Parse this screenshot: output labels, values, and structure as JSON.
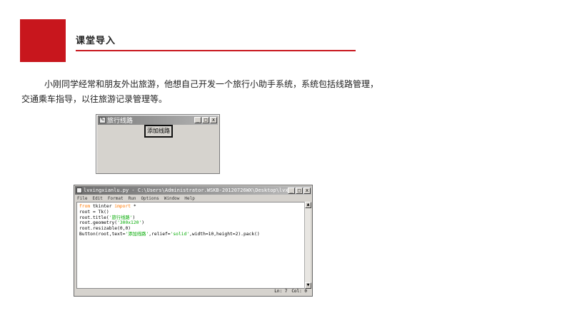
{
  "slide": {
    "header_title": "课堂导入",
    "intro_text": "小刚同学经常和朋友外出旅游，他想自己开发一个旅行小助手系统，系统包括线路管理，交通乘车指导，以往旅游记录管理等。",
    "accent_color": "#c8161d"
  },
  "tk_window": {
    "title": "旅行线路",
    "button_label": "添加线路",
    "window_buttons": [
      "_",
      "□",
      "x"
    ]
  },
  "idle_window": {
    "title": "lvxingxianlu.py - C:\\Users\\Administrator.WSKB-20120726WX\\Desktop\\lvxi...",
    "window_buttons": [
      "_",
      "□",
      "x"
    ],
    "menu": [
      "File",
      "Edit",
      "Format",
      "Run",
      "Options",
      "Window",
      "Help"
    ],
    "code_lines": [
      {
        "parts": [
          {
            "t": "from",
            "c": "kw"
          },
          {
            "t": " tkinter ",
            "c": ""
          },
          {
            "t": "import",
            "c": "kw"
          },
          {
            "t": " *",
            "c": ""
          }
        ]
      },
      {
        "parts": [
          {
            "t": "root = Tk()",
            "c": ""
          }
        ]
      },
      {
        "parts": [
          {
            "t": "root.title(",
            "c": ""
          },
          {
            "t": "'旅行线路'",
            "c": "str"
          },
          {
            "t": ")",
            "c": ""
          }
        ]
      },
      {
        "parts": [
          {
            "t": "root.geometry(",
            "c": ""
          },
          {
            "t": "'300x120'",
            "c": "str"
          },
          {
            "t": ")",
            "c": ""
          }
        ]
      },
      {
        "parts": [
          {
            "t": "root.resizable(0,0)",
            "c": ""
          }
        ]
      },
      {
        "parts": [
          {
            "t": "Button(root,text=",
            "c": ""
          },
          {
            "t": "'添加线路'",
            "c": "str"
          },
          {
            "t": ",relief=",
            "c": ""
          },
          {
            "t": "'solid'",
            "c": "str"
          },
          {
            "t": ",width=10,height=2).pack()",
            "c": ""
          }
        ]
      }
    ],
    "status": {
      "line": "Ln: 7",
      "col": "Col: 0"
    }
  }
}
